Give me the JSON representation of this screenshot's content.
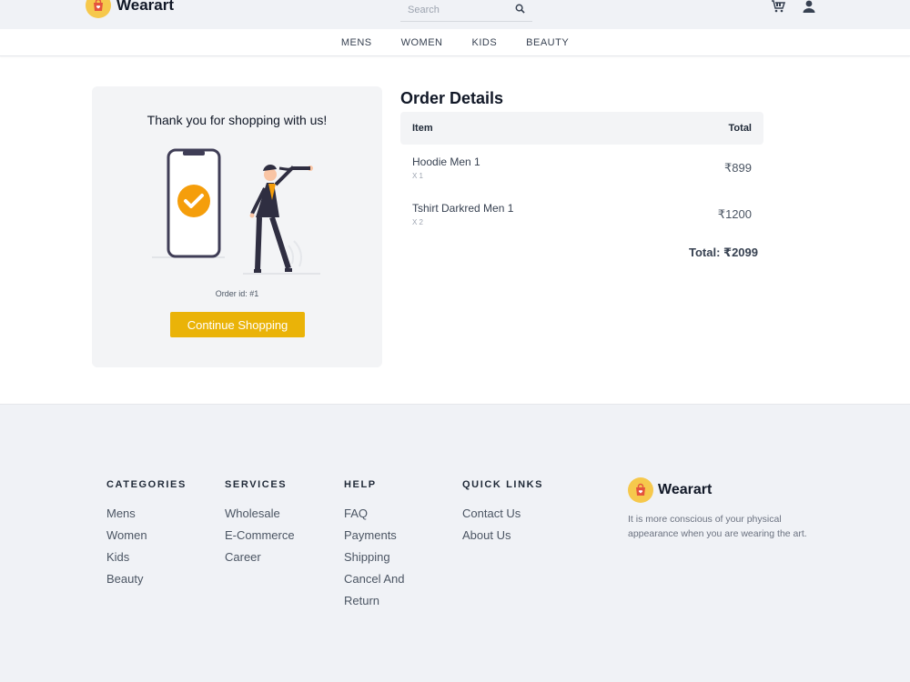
{
  "header": {
    "brand": "Wearart",
    "search_placeholder": "Search",
    "nav": [
      "MENS",
      "WOMEN",
      "KIDS",
      "BEAUTY"
    ]
  },
  "confirmation": {
    "heading": "Thank you for shopping with us!",
    "order_id": "Order id: #1",
    "continue_label": "Continue Shopping"
  },
  "order": {
    "title": "Order Details",
    "col_item": "Item",
    "col_total": "Total",
    "items": [
      {
        "name": "Hoodie Men 1",
        "qty": "X 1",
        "price": "₹899"
      },
      {
        "name": "Tshirt Darkred Men 1",
        "qty": "X 2",
        "price": "₹1200"
      }
    ],
    "total": "Total: ₹2099"
  },
  "footer": {
    "columns": [
      {
        "title": "CATEGORIES",
        "links": [
          "Mens",
          "Women",
          "Kids",
          "Beauty"
        ]
      },
      {
        "title": "SERVICES",
        "links": [
          "Wholesale",
          "E-Commerce",
          "Career"
        ]
      },
      {
        "title": "HELP",
        "links": [
          "FAQ",
          "Payments",
          "Shipping",
          "Cancel And",
          "Return"
        ]
      },
      {
        "title": "QUICK LINKS",
        "links": [
          "Contact Us",
          "About Us"
        ]
      }
    ],
    "brand": "Wearart",
    "tagline": "It is more conscious of your physical appearance when you are wearing the art."
  },
  "colors": {
    "accent": "#eab308",
    "logo_bg": "#f6c84c",
    "panel_bg": "#f3f4f6",
    "footer_bg": "#f0f2f6"
  },
  "icons": [
    "logo-bag-icon",
    "search-icon",
    "cart-icon",
    "user-icon",
    "check-icon"
  ]
}
